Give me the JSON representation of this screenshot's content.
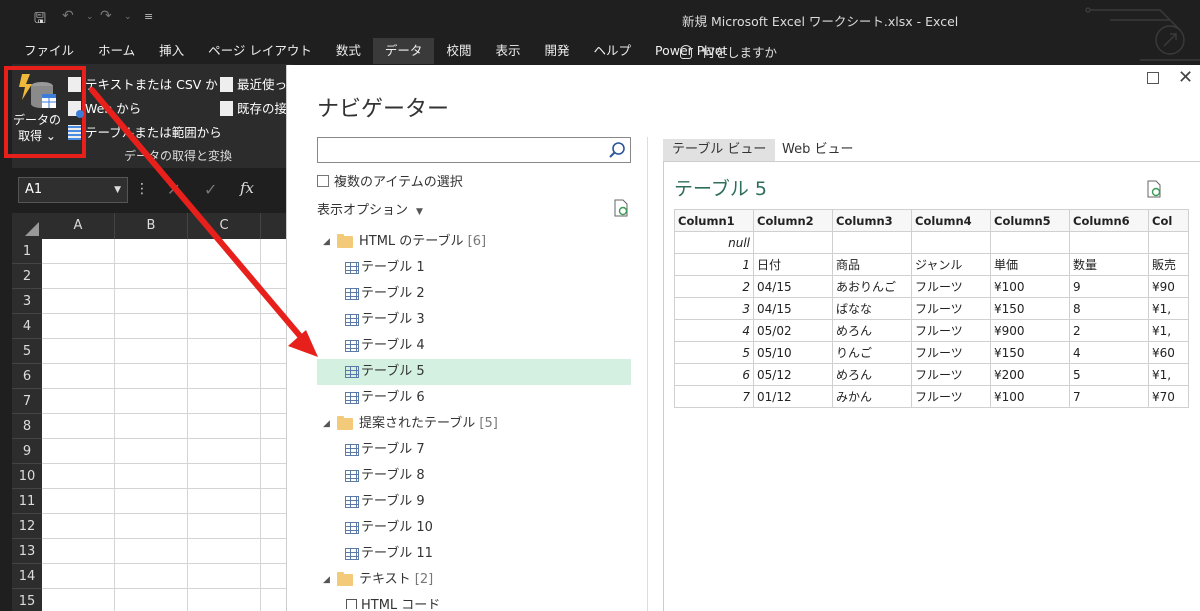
{
  "window": {
    "title": "新規 Microsoft Excel ワークシート.xlsx  -  Excel"
  },
  "qat": {
    "save_icon": "save-icon",
    "undo_icon": "undo-icon",
    "redo_icon": "redo-icon",
    "customize_icon": "customize-qat-icon"
  },
  "ribbon": {
    "tabs": [
      "ファイル",
      "ホーム",
      "挿入",
      "ページ レイアウト",
      "数式",
      "データ",
      "校閲",
      "表示",
      "開発",
      "ヘルプ",
      "Power Pivot"
    ],
    "active_tab": "データ",
    "tell_me": "何をしますか",
    "get_data_label": "データの\n取得 ⌄",
    "text_csv": "テキストまたは CSV から",
    "web": "Web から",
    "table_range": "テーブルまたは範囲から",
    "recent": "最近使った",
    "existing": "既存の接",
    "group_label": "データの取得と変換"
  },
  "formula_bar": {
    "name_box": "A1",
    "fx": "fx"
  },
  "grid": {
    "columns": [
      "A",
      "B",
      "C"
    ],
    "rows": [
      "1",
      "2",
      "3",
      "4",
      "5",
      "6",
      "7",
      "8",
      "9",
      "10",
      "11",
      "12",
      "13",
      "14",
      "15"
    ]
  },
  "navigator": {
    "title": "ナビゲーター",
    "search_placeholder": "",
    "multi_select": "複数のアイテムの選択",
    "display_options": "表示オプション",
    "tree": [
      {
        "type": "folder",
        "label": "HTML のテーブル",
        "count": "[6]"
      },
      {
        "type": "table",
        "label": "テーブル 1"
      },
      {
        "type": "table",
        "label": "テーブル 2"
      },
      {
        "type": "table",
        "label": "テーブル 3"
      },
      {
        "type": "table",
        "label": "テーブル 4"
      },
      {
        "type": "table",
        "label": "テーブル 5",
        "selected": true
      },
      {
        "type": "table",
        "label": "テーブル 6"
      },
      {
        "type": "folder",
        "label": "提案されたテーブル",
        "count": "[5]"
      },
      {
        "type": "table",
        "label": "テーブル 7"
      },
      {
        "type": "table",
        "label": "テーブル 8"
      },
      {
        "type": "table",
        "label": "テーブル 9"
      },
      {
        "type": "table",
        "label": "テーブル 10"
      },
      {
        "type": "table",
        "label": "テーブル 11"
      },
      {
        "type": "folder",
        "label": "テキスト",
        "count": "[2]"
      },
      {
        "type": "doc",
        "label": "HTML コード"
      }
    ],
    "tabs": {
      "table_view": "テーブル ビュー",
      "web_view": "Web ビュー"
    },
    "preview": {
      "title": "テーブル 5",
      "columns": [
        "Column1",
        "Column2",
        "Column3",
        "Column4",
        "Column5",
        "Column6",
        "Col"
      ],
      "rows": [
        [
          "null",
          "",
          "",
          "",
          "",
          "",
          ""
        ],
        [
          "1",
          "日付",
          "商品",
          "ジャンル",
          "単価",
          "数量",
          "販売"
        ],
        [
          "2",
          "04/15",
          "あおりんご",
          "フルーツ",
          "¥100",
          "9",
          "¥90"
        ],
        [
          "3",
          "04/15",
          "ばなな",
          "フルーツ",
          "¥150",
          "8",
          "¥1,"
        ],
        [
          "4",
          "05/02",
          "めろん",
          "フルーツ",
          "¥900",
          "2",
          "¥1,"
        ],
        [
          "5",
          "05/10",
          "りんご",
          "フルーツ",
          "¥150",
          "4",
          "¥60"
        ],
        [
          "6",
          "05/12",
          "めろん",
          "フルーツ",
          "¥200",
          "5",
          "¥1,"
        ],
        [
          "7",
          "01/12",
          "みかん",
          "フルーツ",
          "¥100",
          "7",
          "¥70"
        ]
      ]
    }
  },
  "colors": {
    "highlight": "#e8201c",
    "selected_row": "#d4f0e0",
    "preview_title": "#2e6e5c"
  }
}
